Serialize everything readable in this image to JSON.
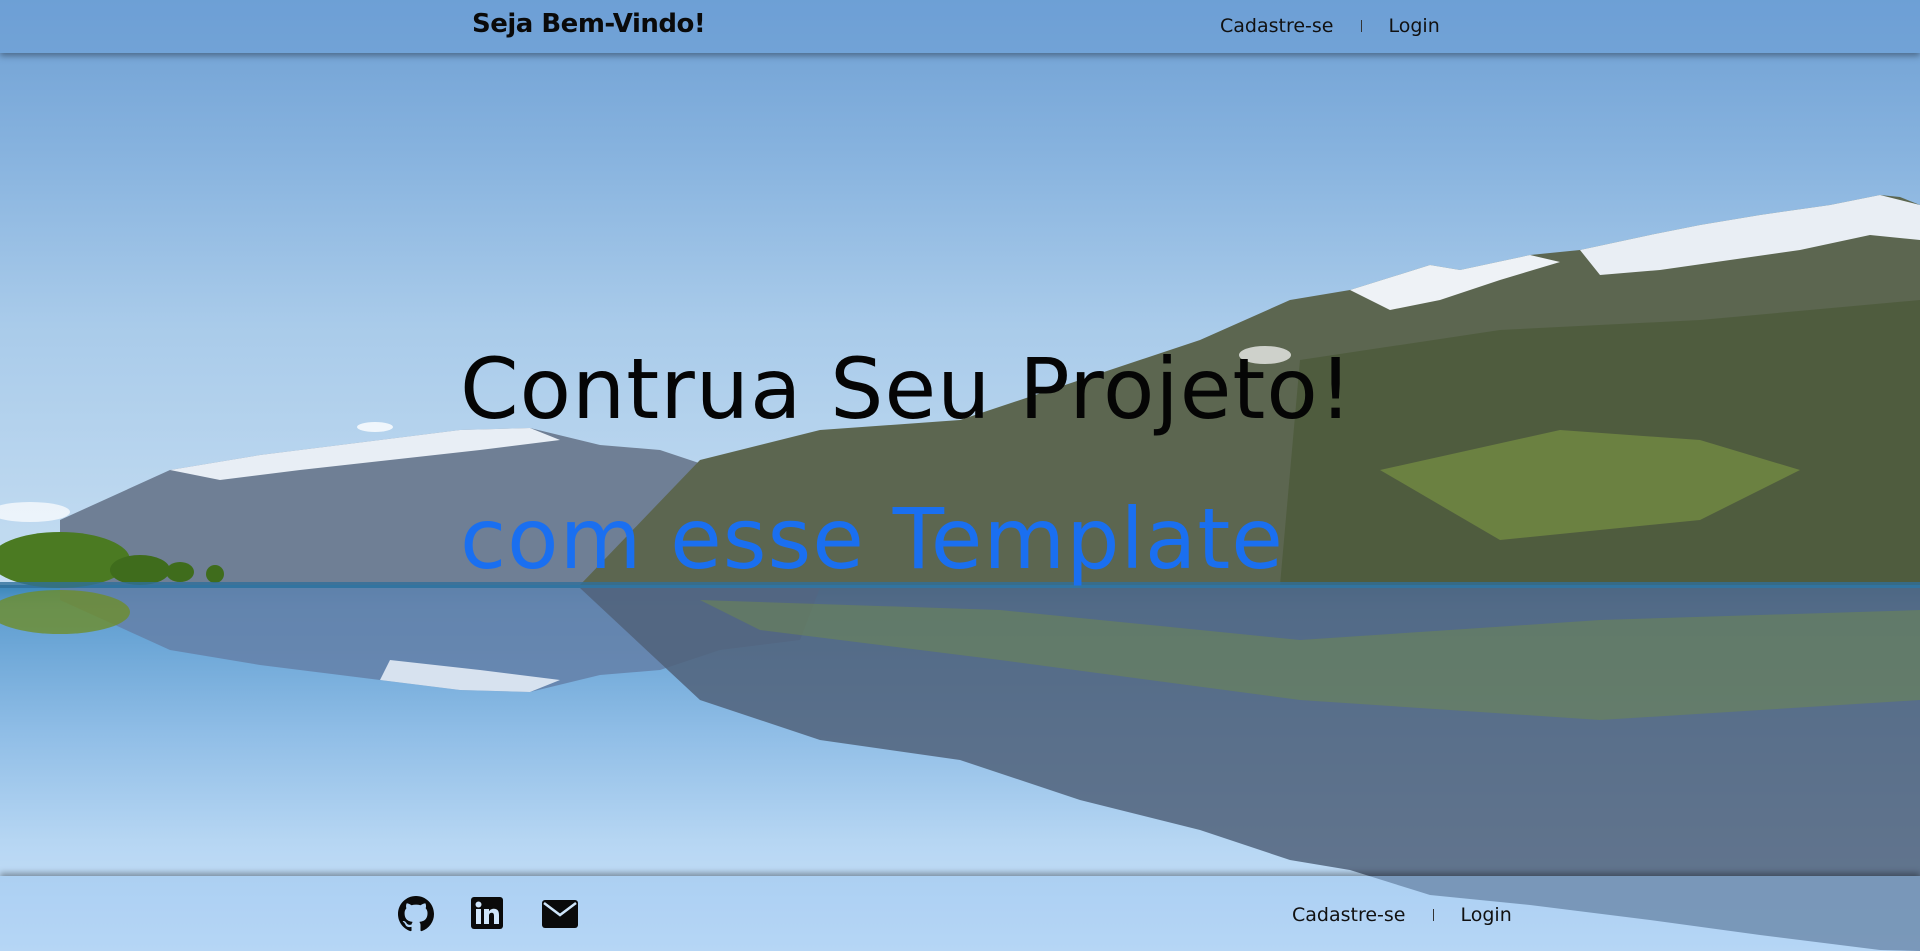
{
  "header": {
    "brand": "Seja Bem-Vindo!",
    "nav": [
      {
        "label": "Cadastre-se"
      },
      {
        "label": "Login"
      }
    ]
  },
  "hero": {
    "title": "Contrua Seu Projeto!",
    "subtitle": "com esse Template"
  },
  "footer": {
    "socials": [
      {
        "icon": "github-icon"
      },
      {
        "icon": "linkedin-icon"
      },
      {
        "icon": "email-icon"
      }
    ],
    "nav": [
      {
        "label": "Cadastre-se"
      },
      {
        "label": "Login"
      }
    ]
  },
  "colors": {
    "accent": "#1a6ff0",
    "text": "#050505"
  }
}
